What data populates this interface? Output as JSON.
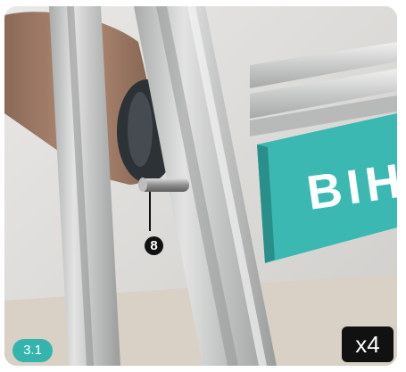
{
  "illustration": {
    "panel_text": "BIH",
    "part_callout": "8",
    "step_number": "3.1",
    "quantity": "x4"
  },
  "colors": {
    "accent_teal": "#35b4ad",
    "panel_teal": "#3bb8b2",
    "badge_black": "#111111"
  }
}
